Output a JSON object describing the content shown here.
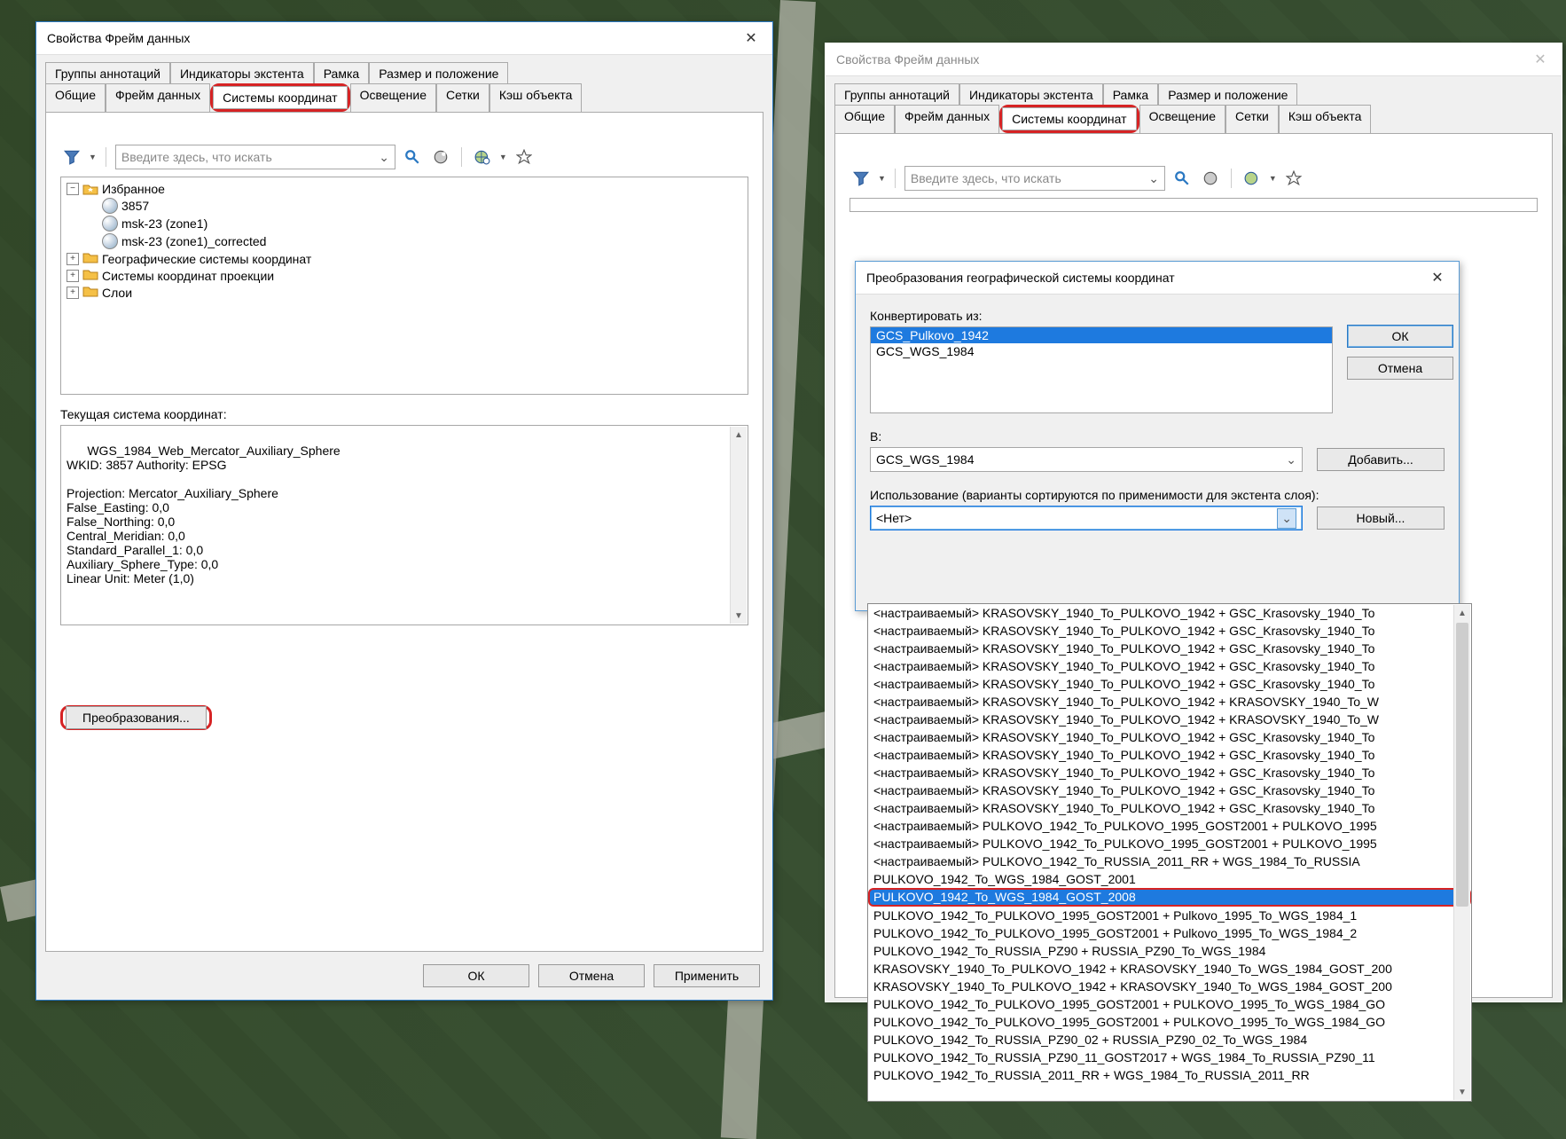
{
  "background": "satellite imagery (coastline, roads, vegetation)",
  "dialog1": {
    "title": "Свойства Фрейм данных",
    "tabs_row1": [
      "Группы аннотаций",
      "Индикаторы экстента",
      "Рамка",
      "Размер и положение"
    ],
    "tabs_row2": [
      "Общие",
      "Фрейм данных",
      "Системы координат",
      "Освещение",
      "Сетки",
      "Кэш объекта"
    ],
    "active_tab": "Системы координат",
    "search_placeholder": "Введите здесь, что искать",
    "tree": {
      "favorites_label": "Избранное",
      "favorites_items": [
        "3857",
        "msk-23 (zone1)",
        "msk-23 (zone1)_corrected"
      ],
      "folders": [
        "Географические системы координат",
        "Системы координат проекции",
        "Слои"
      ]
    },
    "current_cs_label": "Текущая система координат:",
    "current_cs_text": "WGS_1984_Web_Mercator_Auxiliary_Sphere\nWKID: 3857 Authority: EPSG\n\nProjection: Mercator_Auxiliary_Sphere\nFalse_Easting: 0,0\nFalse_Northing: 0,0\nCentral_Meridian: 0,0\nStandard_Parallel_1: 0,0\nAuxiliary_Sphere_Type: 0,0\nLinear Unit: Meter (1,0)",
    "transform_btn": "Преобразования...",
    "ok": "ОК",
    "cancel": "Отмена",
    "apply": "Применить"
  },
  "dialog2": {
    "title": "Свойства Фрейм данных",
    "tabs_row1": [
      "Группы аннотаций",
      "Индикаторы экстента",
      "Рамка",
      "Размер и положение"
    ],
    "tabs_row2": [
      "Общие",
      "Фрейм данных",
      "Системы координат",
      "Освещение",
      "Сетки",
      "Кэш объекта"
    ],
    "active_tab": "Системы координат",
    "search_placeholder": "Введите здесь, что искать",
    "sub": {
      "title": "Преобразования географической системы координат",
      "from_label": "Конвертировать из:",
      "from_items": [
        "GCS_Pulkovo_1942",
        "GCS_WGS_1984"
      ],
      "from_selected": "GCS_Pulkovo_1942",
      "to_label": "В:",
      "to_value": "GCS_WGS_1984",
      "add_btn": "Добавить...",
      "use_label": "Использование (варианты сортируются по применимости для экстента слоя):",
      "use_value": "<Нет>",
      "new_btn": "Новый...",
      "ok": "ОК",
      "cancel": "Отмена",
      "dropdown_items": [
        "<настраиваемый> KRASOVSKY_1940_To_PULKOVO_1942 + GSC_Krasovsky_1940_To",
        "<настраиваемый> KRASOVSKY_1940_To_PULKOVO_1942 + GSC_Krasovsky_1940_To",
        "<настраиваемый> KRASOVSKY_1940_To_PULKOVO_1942 + GSC_Krasovsky_1940_To",
        "<настраиваемый> KRASOVSKY_1940_To_PULKOVO_1942 + GSC_Krasovsky_1940_To",
        "<настраиваемый> KRASOVSKY_1940_To_PULKOVO_1942 + GSC_Krasovsky_1940_To",
        "<настраиваемый> KRASOVSKY_1940_To_PULKOVO_1942 + KRASOVSKY_1940_To_W",
        "<настраиваемый> KRASOVSKY_1940_To_PULKOVO_1942 + KRASOVSKY_1940_To_W",
        "<настраиваемый> KRASOVSKY_1940_To_PULKOVO_1942 + GSC_Krasovsky_1940_To",
        "<настраиваемый> KRASOVSKY_1940_To_PULKOVO_1942 + GSC_Krasovsky_1940_To",
        "<настраиваемый> KRASOVSKY_1940_To_PULKOVO_1942 + GSC_Krasovsky_1940_To",
        "<настраиваемый> KRASOVSKY_1940_To_PULKOVO_1942 + GSC_Krasovsky_1940_To",
        "<настраиваемый> KRASOVSKY_1940_To_PULKOVO_1942 + GSC_Krasovsky_1940_To",
        "<настраиваемый> PULKOVO_1942_To_PULKOVO_1995_GOST2001 + PULKOVO_1995",
        "<настраиваемый> PULKOVO_1942_To_PULKOVO_1995_GOST2001 + PULKOVO_1995",
        "<настраиваемый> PULKOVO_1942_To_RUSSIA_2011_RR + WGS_1984_To_RUSSIA",
        "PULKOVO_1942_To_WGS_1984_GOST_2001",
        "PULKOVO_1942_To_WGS_1984_GOST_2008",
        "PULKOVO_1942_To_PULKOVO_1995_GOST2001 + Pulkovo_1995_To_WGS_1984_1",
        "PULKOVO_1942_To_PULKOVO_1995_GOST2001 + Pulkovo_1995_To_WGS_1984_2",
        "PULKOVO_1942_To_RUSSIA_PZ90 + RUSSIA_PZ90_To_WGS_1984",
        "KRASOVSKY_1940_To_PULKOVO_1942 + KRASOVSKY_1940_To_WGS_1984_GOST_200",
        "KRASOVSKY_1940_To_PULKOVO_1942 + KRASOVSKY_1940_To_WGS_1984_GOST_200",
        "PULKOVO_1942_To_PULKOVO_1995_GOST2001 + PULKOVO_1995_To_WGS_1984_GO",
        "PULKOVO_1942_To_PULKOVO_1995_GOST2001 + PULKOVO_1995_To_WGS_1984_GO",
        "PULKOVO_1942_To_RUSSIA_PZ90_02 + RUSSIA_PZ90_02_To_WGS_1984",
        "PULKOVO_1942_To_RUSSIA_PZ90_11_GOST2017 + WGS_1984_To_RUSSIA_PZ90_11",
        "PULKOVO_1942_To_RUSSIA_2011_RR + WGS_1984_To_RUSSIA_2011_RR"
      ],
      "dropdown_selected_index": 16
    }
  }
}
